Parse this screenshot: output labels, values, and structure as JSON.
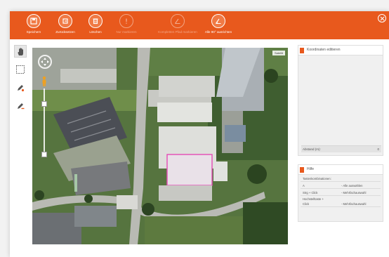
{
  "toolbar": {
    "buttons": [
      {
        "label": "Speichern",
        "icon": "save-icon",
        "enabled": true
      },
      {
        "label": "Zurücksetzen",
        "icon": "reset-icon",
        "enabled": true
      },
      {
        "label": "Löschen",
        "icon": "trash-icon",
        "enabled": true
      },
      {
        "label": "Nur markieren",
        "icon": "warning-icon",
        "enabled": false
      },
      {
        "label": "Kompletten Pfad markieren",
        "icon": "angle-icon",
        "enabled": false
      },
      {
        "label": "Alle 90° ausrichten",
        "icon": "angle-icon",
        "enabled": true
      }
    ],
    "accent": "#e8591d"
  },
  "map": {
    "tag": "Satellit"
  },
  "coord_panel": {
    "title": "Koordinaten editieren",
    "distance_label": "Abstand (m):",
    "distance_value": "0"
  },
  "help_panel": {
    "title": "Hilfe",
    "section": "Tastenkombinationen:",
    "rows": [
      {
        "key": "A",
        "value": "- Alle auswählen"
      },
      {
        "key": "Strg + Click",
        "value": "- Mehrfachauswahl"
      },
      {
        "key": "Hochstelltaste +",
        "key2": "Click",
        "value": "- Mehrfachauswahl"
      }
    ]
  }
}
